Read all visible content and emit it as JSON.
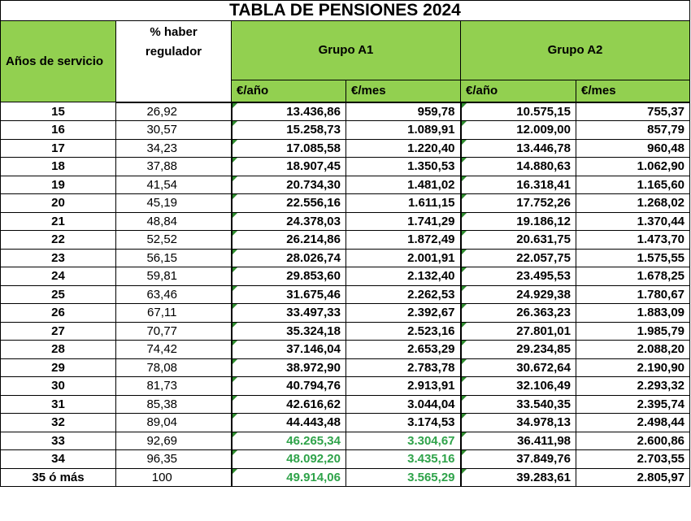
{
  "title": "TABLA DE PENSIONES 2024",
  "headers": {
    "years": "Años de servicio",
    "pct_line1": "% haber",
    "pct_line2": "regulador",
    "group_a1": "Grupo A1",
    "group_a2": "Grupo A2",
    "per_year": "€/año",
    "per_month": "€/mes"
  },
  "colors": {
    "header_green": "#92d050",
    "highlight_green": "#2fa34a"
  },
  "rows": [
    {
      "years": "15",
      "pct": "26,92",
      "a1_year": "13.436,86",
      "a1_month": "959,78",
      "a2_year": "10.575,15",
      "a2_month": "755,37"
    },
    {
      "years": "16",
      "pct": "30,57",
      "a1_year": "15.258,73",
      "a1_month": "1.089,91",
      "a2_year": "12.009,00",
      "a2_month": "857,79"
    },
    {
      "years": "17",
      "pct": "34,23",
      "a1_year": "17.085,58",
      "a1_month": "1.220,40",
      "a2_year": "13.446,78",
      "a2_month": "960,48"
    },
    {
      "years": "18",
      "pct": "37,88",
      "a1_year": "18.907,45",
      "a1_month": "1.350,53",
      "a2_year": "14.880,63",
      "a2_month": "1.062,90"
    },
    {
      "years": "19",
      "pct": "41,54",
      "a1_year": "20.734,30",
      "a1_month": "1.481,02",
      "a2_year": "16.318,41",
      "a2_month": "1.165,60"
    },
    {
      "years": "20",
      "pct": "45,19",
      "a1_year": "22.556,16",
      "a1_month": "1.611,15",
      "a2_year": "17.752,26",
      "a2_month": "1.268,02"
    },
    {
      "years": "21",
      "pct": "48,84",
      "a1_year": "24.378,03",
      "a1_month": "1.741,29",
      "a2_year": "19.186,12",
      "a2_month": "1.370,44"
    },
    {
      "years": "22",
      "pct": "52,52",
      "a1_year": "26.214,86",
      "a1_month": "1.872,49",
      "a2_year": "20.631,75",
      "a2_month": "1.473,70"
    },
    {
      "years": "23",
      "pct": "56,15",
      "a1_year": "28.026,74",
      "a1_month": "2.001,91",
      "a2_year": "22.057,75",
      "a2_month": "1.575,55"
    },
    {
      "years": "24",
      "pct": "59,81",
      "a1_year": "29.853,60",
      "a1_month": "2.132,40",
      "a2_year": "23.495,53",
      "a2_month": "1.678,25"
    },
    {
      "years": "25",
      "pct": "63,46",
      "a1_year": "31.675,46",
      "a1_month": "2.262,53",
      "a2_year": "24.929,38",
      "a2_month": "1.780,67"
    },
    {
      "years": "26",
      "pct": "67,11",
      "a1_year": "33.497,33",
      "a1_month": "2.392,67",
      "a2_year": "26.363,23",
      "a2_month": "1.883,09"
    },
    {
      "years": "27",
      "pct": "70,77",
      "a1_year": "35.324,18",
      "a1_month": "2.523,16",
      "a2_year": "27.801,01",
      "a2_month": "1.985,79"
    },
    {
      "years": "28",
      "pct": "74,42",
      "a1_year": "37.146,04",
      "a1_month": "2.653,29",
      "a2_year": "29.234,85",
      "a2_month": "2.088,20"
    },
    {
      "years": "29",
      "pct": "78,08",
      "a1_year": "38.972,90",
      "a1_month": "2.783,78",
      "a2_year": "30.672,64",
      "a2_month": "2.190,90"
    },
    {
      "years": "30",
      "pct": "81,73",
      "a1_year": "40.794,76",
      "a1_month": "2.913,91",
      "a2_year": "32.106,49",
      "a2_month": "2.293,32"
    },
    {
      "years": "31",
      "pct": "85,38",
      "a1_year": "42.616,62",
      "a1_month": "3.044,04",
      "a2_year": "33.540,35",
      "a2_month": "2.395,74"
    },
    {
      "years": "32",
      "pct": "89,04",
      "a1_year": "44.443,48",
      "a1_month": "3.174,53",
      "a2_year": "34.978,13",
      "a2_month": "2.498,44"
    },
    {
      "years": "33",
      "pct": "92,69",
      "a1_year": "46.265,34",
      "a1_month": "3.304,67",
      "a2_year": "36.411,98",
      "a2_month": "2.600,86",
      "highlight": true
    },
    {
      "years": "34",
      "pct": "96,35",
      "a1_year": "48.092,20",
      "a1_month": "3.435,16",
      "a2_year": "37.849,76",
      "a2_month": "2.703,55",
      "highlight": true
    },
    {
      "years": "35 ó más",
      "pct": "100",
      "a1_year": "49.914,06",
      "a1_month": "3.565,29",
      "a2_year": "39.283,61",
      "a2_month": "2.805,97",
      "highlight": true
    }
  ]
}
